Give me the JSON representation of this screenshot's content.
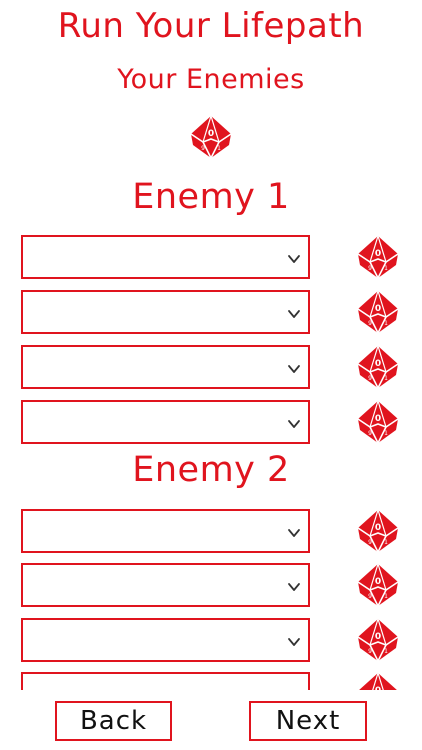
{
  "header": {
    "title": "Run Your Lifepath",
    "section": "Your Enemies",
    "top_die_icon": "d10-die-icon"
  },
  "enemies": [
    {
      "heading": "Enemy 1",
      "fields": [
        "",
        "",
        "",
        ""
      ]
    },
    {
      "heading": "Enemy 2",
      "fields": [
        "",
        "",
        "",
        ""
      ]
    }
  ],
  "nav": {
    "back_label": "Back",
    "next_label": "Next"
  },
  "colors": {
    "accent": "#e0141e",
    "background": "#ffffff"
  }
}
